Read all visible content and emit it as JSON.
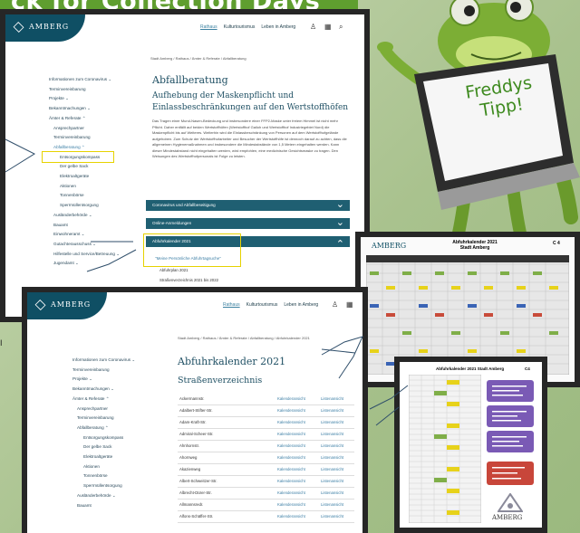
{
  "banner": {
    "text": "ck for Collection Days"
  },
  "badge": {
    "line1": "Freddys",
    "line2": "Tipp!"
  },
  "top_screen": {
    "brand": "AMBERG",
    "nav": [
      "Rathaus",
      "Kulturtourismus",
      "Leben in Amberg"
    ],
    "breadcrumb": "Stadt Amberg / Rathaus / Ämter & Referate / Abfallberatung",
    "sidebar": [
      "Informationen zum Coronavirus ⌄",
      "Terminvereinbarung",
      "Projekte ⌄",
      "Bekanntmachungen ⌄",
      "Ämter & Referate ⌃",
      "Ansprechpartner",
      "Terminvereinbarung",
      "Abfallberatung ⌃",
      "Entsorgungskompass",
      "Der gelbe Sack",
      "Elektroaltgeräte",
      "Aktionen",
      "Tonnenbörse",
      "Sperrmüllentsorgung",
      "Ausländerbehörde ⌄",
      "Bauamt",
      "Einwohneramt ⌄",
      "Gutachterausschuss ⌄",
      "Hilfestelle und Service/Betreuung ⌄",
      "Jugendamt ⌄"
    ],
    "title": "Abfallberatung",
    "subtitle1": "Aufhebung der Maskenpflicht und",
    "subtitle2": "Einlassbeschränkungen auf den Wertstoffhöfen",
    "paragraph": "Das Tragen einer Mund-Nasen-Bedeckung und insbesondere einer FFP2-Maske unter freiem Himmel ist nicht mehr Pflicht. Daher entfällt auf beiden Wertstoffhöfen (Wertstoffhof Gailoh und Wertstoffhof Industriegebiet Nord) die Maskenpflicht bis auf Weiteres. Weiterhin wird die Einlassbeschränkung von Personen auf dem Wertstoffhofgelände aufgehoben. Zum Schutz der Wertstoffhofarbeiter und Besucher der Wertstoffhöfe ist dennoch darauf zu achten, dass die allgemeinen Hygienemaßnahmen und insbesondere die Mindestabstände von 1,5 Metern eingehalten werden. Kann dieser Mindestabstand nicht eingehalten werden, wird empfohlen, eine medizinische Gesichtsmaske zu tragen. Den Weisungen des Wertstoffhofpersonals ist Folge zu leisten.",
    "accordions": [
      "Coronavirus und Abfallbeseitigung",
      "Online-Anmeldungen",
      "Abfuhrkalender 2021"
    ],
    "accordion_link": "\"Meine Persönliche Abfuhrtagsuche\"",
    "accordion_items": [
      "Abfuhrplan 2021",
      "Straßenverzeichnis 2021 bis 2022"
    ]
  },
  "bottom_screen": {
    "brand": "AMBERG",
    "nav": [
      "Rathaus",
      "Kulturtourismus",
      "Leben in Amberg"
    ],
    "breadcrumb": "Stadt Amberg / Rathaus / Ämter & Referate / Abfallberatung / Abfuhrkalender 2021",
    "sidebar": [
      "Informationen zum Coronavirus ⌄",
      "Terminvereinbarung",
      "Projekte ⌄",
      "Bekanntmachungen ⌄",
      "Ämter & Referate ⌃",
      "Ansprechpartner",
      "Terminvereinbarung",
      "Abfallberatung ⌃",
      "Entsorgungskompass",
      "Der gelbe Sack",
      "Elektroaltgeräte",
      "Aktionen",
      "Tonnenbörse",
      "Sperrmüllentsorgung",
      "Ausländerbehörde ⌄",
      "Bauamt"
    ],
    "title": "Abfuhrkalender 2021",
    "subtitle": "Straßenverzeichnis",
    "streets": [
      "Ackermannstr.",
      "Adalbert-Stifter-Str.",
      "Adam-Kraft-Str.",
      "Admiral-Scheer-Str.",
      "Ahnhornstr.",
      "Ahornweg",
      "Akazienweg",
      "Albert-Schweitzer-Str.",
      "Albrecht-Dürer-Str.",
      "Allmannsredr.",
      "Alfons-Schäffer-Str."
    ],
    "link1": "Kalenderansicht",
    "link2": "Listenansicht"
  },
  "calendar_doc": {
    "title1": "Abfuhrkalender 2021",
    "title2": "Stadt Amberg",
    "code": "C 4",
    "brand": "AMBERG"
  },
  "list_doc": {
    "title": "Abfuhrkalender 2021 Stadt Amberg",
    "code": "C4",
    "brand": "AMBERG"
  },
  "colors": {
    "teal": "#1f5f72",
    "highlight": "#e6d200",
    "frog": "#7cae35",
    "banner": "#5f9e2f",
    "purple": "#7a5ab5"
  }
}
